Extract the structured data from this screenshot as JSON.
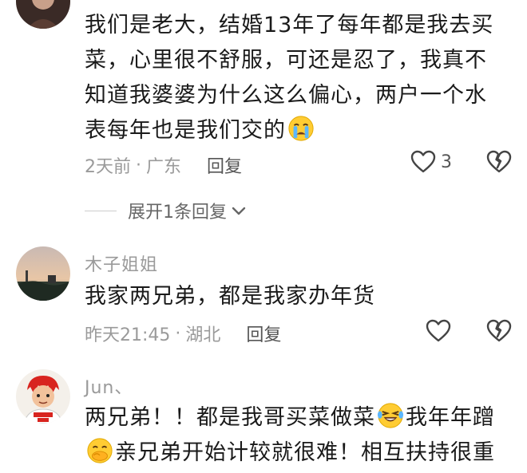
{
  "comments": [
    {
      "text_lines": [
        "我们是老大，结婚13年了每年都是我去买",
        "菜，心里很不舒服，可还是忍了，我真不",
        "知道我婆婆为什么这么偏心，两户一个水",
        "表每年也是我们交的"
      ],
      "time": "2天前",
      "separator": "·",
      "location": "广东",
      "reply_label": "回复",
      "like_count": "3",
      "expand_label": "展开1条回复"
    },
    {
      "username": "木子姐姐",
      "text": "我家两兄弟，都是我家办年货",
      "time": "昨天21:45",
      "separator": "·",
      "location": "湖北",
      "reply_label": "回复"
    },
    {
      "username": "Jun、",
      "line1_a": "两兄弟！！都是我哥买菜做菜",
      "line1_b": "我年年蹭",
      "line2": "亲兄弟开始计较就很难！相互扶持很重"
    }
  ],
  "colors": {
    "text": "#1a1a1a",
    "meta": "#9a9a9a",
    "reply": "#555555"
  },
  "icons": [
    "heart-outline-icon",
    "dislike-broken-heart-icon",
    "chevron-down-icon",
    "crying-emoji-icon",
    "laughing-tears-emoji-icon",
    "shy-smile-emoji-icon"
  ]
}
